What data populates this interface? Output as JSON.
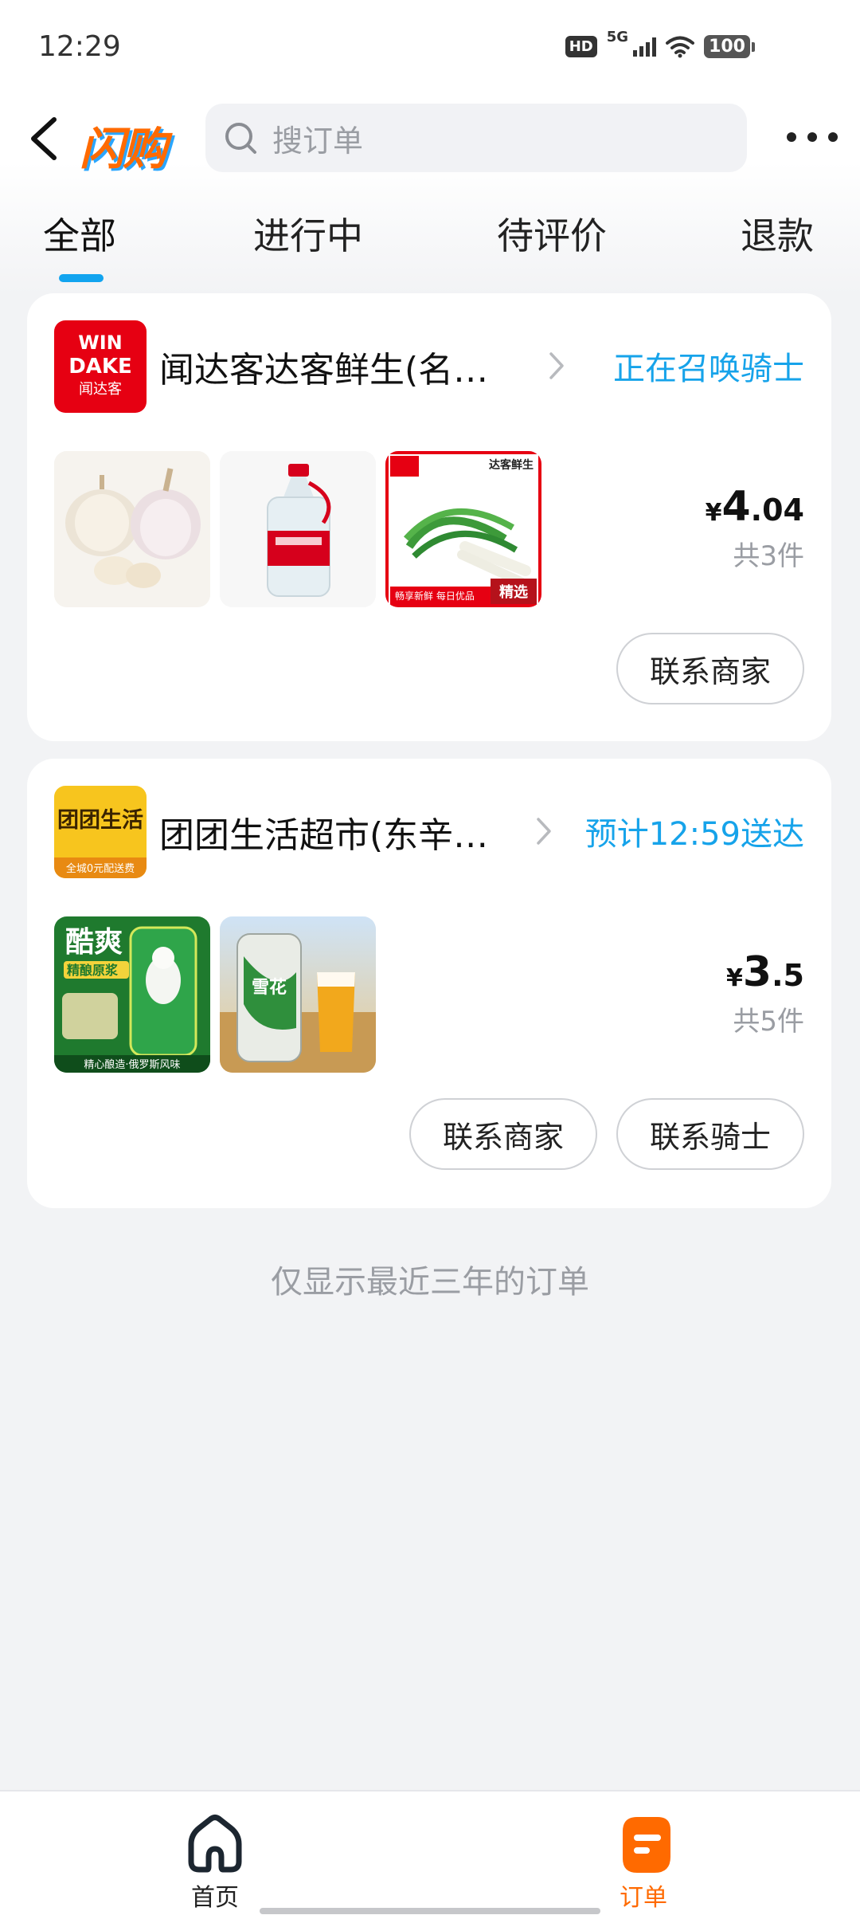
{
  "status_bar": {
    "time": "12:29",
    "hd_badge": "HD",
    "network": "5G",
    "battery": "100"
  },
  "header": {
    "brand": "闪购",
    "search_placeholder": "搜订单"
  },
  "tabs": [
    {
      "label": "全部",
      "active": true
    },
    {
      "label": "进行中",
      "active": false
    },
    {
      "label": "待评价",
      "active": false
    },
    {
      "label": "退款",
      "active": false
    }
  ],
  "orders": [
    {
      "store_name": "闻达客达客鲜生(名…",
      "store_logo": {
        "line1": "WIN",
        "line2": "DAKE",
        "line3": "闻达客"
      },
      "status": "正在召唤骑士",
      "thumb_labels": {
        "tag": "达客鲜生",
        "footer": "畅享新鲜 每日优品",
        "badge": "精选"
      },
      "price_symbol": "¥",
      "price_int": "4",
      "price_dec": ".04",
      "item_count": "共3件",
      "buttons": {
        "contact_merchant": "联系商家"
      }
    },
    {
      "store_name": "团团生活超市(东辛…",
      "store_logo": {
        "line1": "团团生活",
        "line2": "全城0元配送费"
      },
      "status": "预计12:59送达",
      "thumb_labels": {
        "title": "酷爽",
        "sub": "精酿原浆",
        "footer": "精心酿造·俄罗斯风味",
        "can_text": "雪花"
      },
      "price_symbol": "¥",
      "price_int": "3",
      "price_dec": ".5",
      "item_count": "共5件",
      "buttons": {
        "contact_merchant": "联系商家",
        "contact_rider": "联系骑士"
      }
    }
  ],
  "footnote": "仅显示最近三年的订单",
  "bottom_nav": [
    {
      "label": "首页",
      "active": false
    },
    {
      "label": "订单",
      "active": true
    }
  ],
  "colors": {
    "accent_blue": "#16a3ea",
    "brand_orange": "#ff6a00",
    "background": "#f2f3f5"
  }
}
